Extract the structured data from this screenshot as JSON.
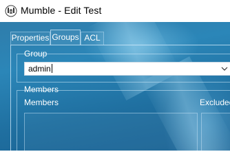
{
  "window": {
    "title": "Mumble - Edit Test",
    "icon": "mumble-icon"
  },
  "tabs": [
    {
      "label": "Properties",
      "selected": false
    },
    {
      "label": "Groups",
      "selected": true
    },
    {
      "label": "ACL",
      "selected": false
    }
  ],
  "group_section": {
    "legend": "Group",
    "selected_value": "admin",
    "dropdown_icon": "chevron-down-icon"
  },
  "members_section": {
    "legend": "Members",
    "members_column_label": "Members",
    "excluded_column_label": "Excluded"
  },
  "colors": {
    "titlebar": "#ffffff",
    "client_background": "#2b86b8",
    "text_on_glass": "#ffffff"
  }
}
